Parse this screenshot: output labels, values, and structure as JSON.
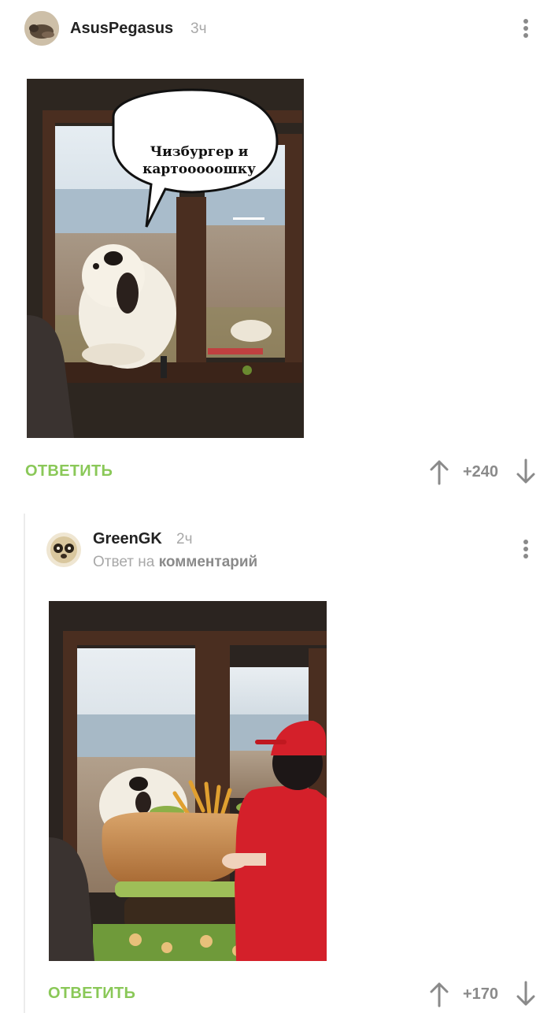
{
  "comment1": {
    "username": "AsusPegasus",
    "time": "3ч",
    "image_caption": "Чизбургер и картооооошку",
    "reply_label": "ОТВЕТИТЬ",
    "rating": "+240"
  },
  "comment2": {
    "username": "GreenGK",
    "time": "2ч",
    "reply_to_prefix": "Ответ на",
    "reply_to_link": "комментарий",
    "reply_label": "ОТВЕТИТЬ",
    "rating": "+170"
  },
  "colors": {
    "accent_green": "#8ac858",
    "muted_gray": "#a8a8a8",
    "icon_gray": "#8a8a8a"
  },
  "icons": [
    "avatar",
    "kebab-menu-icon",
    "arrow-up-icon",
    "arrow-down-icon"
  ]
}
